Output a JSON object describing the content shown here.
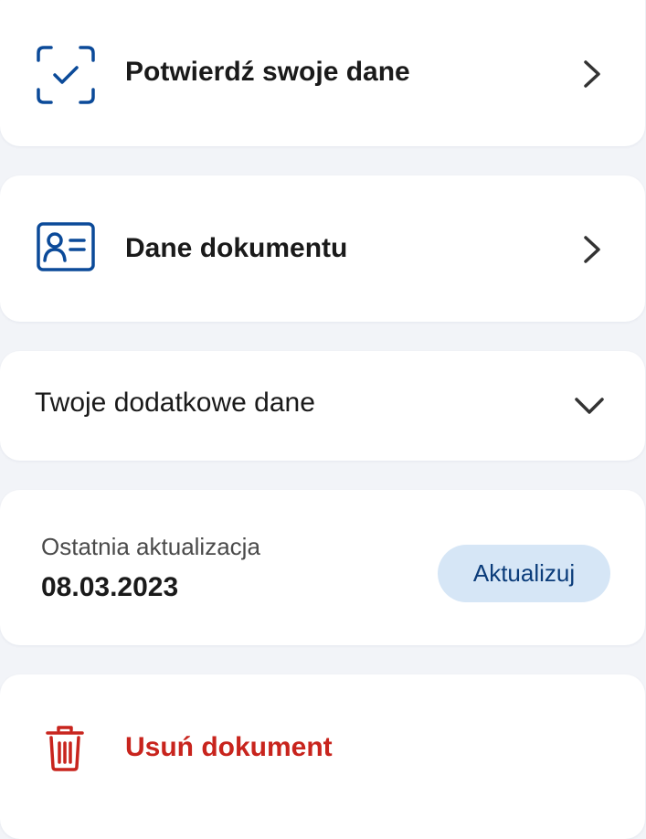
{
  "colors": {
    "background": "#f2f4f8",
    "card": "#ffffff",
    "accent_blue": "#0b4a99",
    "button_bg": "#d6e6f6",
    "button_text": "#0b3c7a",
    "danger": "#c8241d",
    "chevron": "#333333"
  },
  "items": {
    "verify": {
      "label": "Potwierdź swoje dane",
      "icon": "scan-check-icon"
    },
    "document": {
      "label": "Dane dokumentu",
      "icon": "id-card-icon"
    },
    "additional": {
      "label": "Twoje dodatkowe dane",
      "icon": "chevron-down-icon"
    },
    "update": {
      "label": "Ostatnia aktualizacja",
      "date": "08.03.2023",
      "button_label": "Aktualizuj"
    },
    "delete": {
      "label": "Usuń dokument",
      "icon": "trash-icon"
    }
  }
}
